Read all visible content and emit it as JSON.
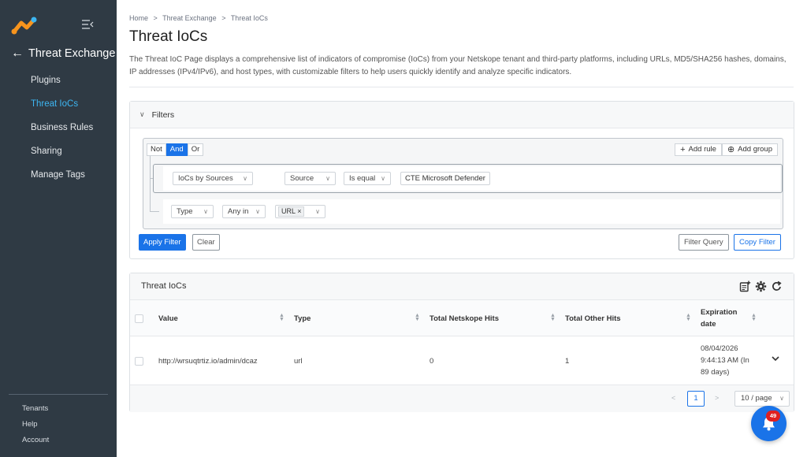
{
  "sidebar": {
    "back_label": "Threat Exchange",
    "items": [
      {
        "label": "Plugins"
      },
      {
        "label": "Threat IoCs"
      },
      {
        "label": "Business Rules"
      },
      {
        "label": "Sharing"
      },
      {
        "label": "Manage Tags"
      }
    ],
    "active_index": 1,
    "bottom_items": [
      {
        "label": "Tenants"
      },
      {
        "label": "Help"
      },
      {
        "label": "Account"
      }
    ]
  },
  "breadcrumb": [
    "Home",
    ">",
    "Threat Exchange",
    ">",
    "Threat IoCs"
  ],
  "page": {
    "title": "Threat IoCs",
    "description": "The Threat IoC Page displays a comprehensive list of indicators of compromise (IoCs) from your Netskope tenant and third-party platforms, including URLs, MD5/SHA256 hashes, domains, IP addresses (IPv4/IPv6), and host types, with customizable filters to help users quickly identify and analyze specific indicators."
  },
  "filters": {
    "title": "Filters",
    "combinators": [
      "Not",
      "And",
      "Or"
    ],
    "active_combinator": "And",
    "add_rule": "Add rule",
    "add_group": "Add group",
    "group_rule": {
      "field": "IoCs by Sources",
      "subfield": "Source",
      "operator": "Is equal",
      "value": "CTE Microsoft Defender"
    },
    "rule": {
      "field": "Type",
      "operator": "Any in",
      "chip": "URL",
      "chip_remove": "×"
    },
    "apply": "Apply Filter",
    "clear": "Clear",
    "filter_query": "Filter Query",
    "copy_filter": "Copy Filter"
  },
  "table": {
    "title": "Threat IoCs",
    "columns": [
      "Value",
      "Type",
      "Total Netskope Hits",
      "Total Other Hits",
      "Expiration date"
    ],
    "rows": [
      {
        "value": "http://wrsuqtrtiz.io/admin/dcaz",
        "type": "url",
        "netskope_hits": "0",
        "other_hits": "1",
        "expiration": "08/04/2026 9:44:13 AM (In 89 days)"
      }
    ],
    "pagination": {
      "prev": "<",
      "current_page": "1",
      "next": ">",
      "page_size": "10 / page"
    }
  },
  "notifications": {
    "count": "49"
  },
  "colors": {
    "sidebar_bg": "#2f3a44",
    "active_nav": "#3db6f2",
    "primary": "#1a73e8",
    "badge": "#e02020"
  }
}
